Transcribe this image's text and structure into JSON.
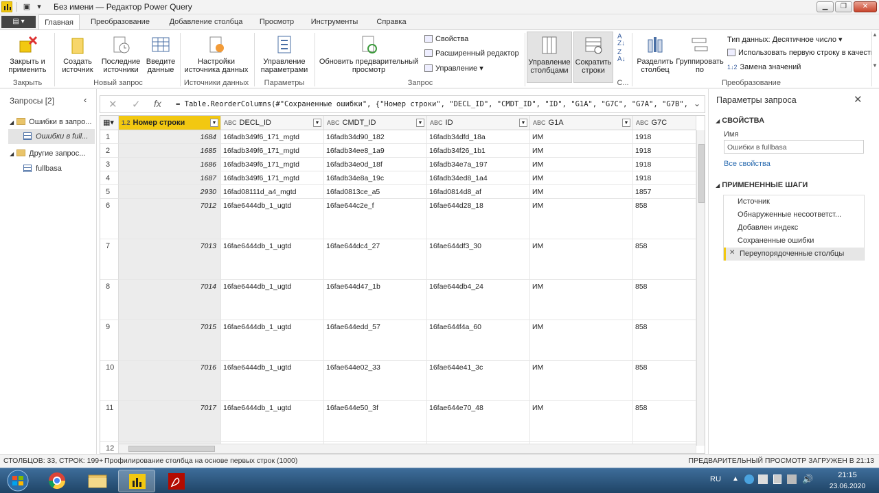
{
  "window": {
    "title": "Без имени — Редактор Power Query",
    "controls": [
      "minimize-icon",
      "restore-icon",
      "close-icon"
    ]
  },
  "tabs": [
    {
      "label": "Главная",
      "active": true
    },
    {
      "label": "Преобразование"
    },
    {
      "label": "Добавление столбца"
    },
    {
      "label": "Просмотр"
    },
    {
      "label": "Инструменты"
    },
    {
      "label": "Справка"
    }
  ],
  "ribbon": {
    "close_apply": "Закрыть и применить",
    "new_source": "Создать источник",
    "recent_sources": "Последние источники",
    "enter_data": "Введите данные",
    "data_source_settings": "Настройки источника данных",
    "manage_params": "Управление параметрами",
    "refresh_preview": "Обновить предварительный просмотр",
    "properties": "Свойства",
    "advanced_editor": "Расширенный редактор",
    "manage": "Управление",
    "manage_columns": "Управление столбцами",
    "reduce_rows": "Сократить строки",
    "split_column": "Разделить столбец",
    "group_by": "Группировать по",
    "data_type": "Тип данных: Десятичное число",
    "first_row_headers": "Использовать первую строку в качестве заголовков",
    "replace_values": "Замена значений",
    "groups": {
      "close": "Закрыть",
      "new_query": "Новый запрос",
      "data_sources": "Источники данных",
      "parameters": "Параметры",
      "query": "Запрос",
      "sort": "С...",
      "transform": "Преобразование"
    }
  },
  "queries": {
    "header": "Запросы [2]",
    "items": [
      {
        "label": "Ошибки в запро...",
        "type": "folder"
      },
      {
        "label": "Ошибки в full...",
        "type": "table",
        "selected": true
      },
      {
        "label": "Другие запрос...",
        "type": "folder"
      },
      {
        "label": "fullbasa",
        "type": "table"
      }
    ]
  },
  "formula": {
    "text": "= Table.ReorderColumns(#\"Сохраненные ошибки\", {\"Номер строки\", \"DECL_ID\", \"CMDT_ID\", \"ID\", \"G1A\", \"G7C\", \"G7A\", \"G7B\","
  },
  "table": {
    "columns": [
      {
        "name": "Номер строки",
        "type": "1.2"
      },
      {
        "name": "DECL_ID",
        "type": "ABC"
      },
      {
        "name": "CMDT_ID",
        "type": "ABC"
      },
      {
        "name": "ID",
        "type": "ABC"
      },
      {
        "name": "G1A",
        "type": "ABC"
      },
      {
        "name": "G7C",
        "type": "ABC"
      }
    ],
    "rows": [
      {
        "n": "1",
        "cells": [
          "1684",
          "16fadb349f6_171_mgtd",
          "16fadb34d90_182",
          "16fadb34dfd_18a",
          "ИМ",
          "1918"
        ]
      },
      {
        "n": "2",
        "cells": [
          "1685",
          "16fadb349f6_171_mgtd",
          "16fadb34ee8_1a9",
          "16fadb34f26_1b1",
          "ИМ",
          "1918"
        ]
      },
      {
        "n": "3",
        "cells": [
          "1686",
          "16fadb349f6_171_mgtd",
          "16fadb34e0d_18f",
          "16fadb34e7a_197",
          "ИМ",
          "1918"
        ]
      },
      {
        "n": "4",
        "cells": [
          "1687",
          "16fadb349f6_171_mgtd",
          "16fadb34e8a_19c",
          "16fadb34ed8_1a4",
          "ИМ",
          "1918"
        ]
      },
      {
        "n": "5",
        "cells": [
          "2930",
          "16fad08111d_a4_mgtd",
          "16fad0813ce_a5",
          "16fad0814d8_af",
          "ИМ",
          "1857"
        ]
      },
      {
        "n": "6",
        "cells": [
          "7012",
          "16fae6444db_1_ugtd",
          "16fae644c2e_f",
          "16fae644d28_18",
          "ИМ",
          "858"
        ]
      },
      {
        "n": "7",
        "cells": [
          "7013",
          "16fae6444db_1_ugtd",
          "16fae644dc4_27",
          "16fae644df3_30",
          "ИМ",
          "858"
        ]
      },
      {
        "n": "8",
        "cells": [
          "7014",
          "16fae6444db_1_ugtd",
          "16fae644d47_1b",
          "16fae644db4_24",
          "ИМ",
          "858"
        ]
      },
      {
        "n": "9",
        "cells": [
          "7015",
          "16fae6444db_1_ugtd",
          "16fae644edd_57",
          "16fae644f4a_60",
          "ИМ",
          "858"
        ]
      },
      {
        "n": "10",
        "cells": [
          "7016",
          "16fae6444db_1_ugtd",
          "16fae644e02_33",
          "16fae644e41_3c",
          "ИМ",
          "858"
        ]
      },
      {
        "n": "11",
        "cells": [
          "7017",
          "16fae6444db_1_ugtd",
          "16fae644e50_3f",
          "16fae644e70_48",
          "ИМ",
          "858"
        ]
      },
      {
        "n": "12",
        "cells": [
          "",
          "",
          "",
          "",
          "",
          ""
        ]
      }
    ]
  },
  "settings": {
    "title": "Параметры запроса",
    "properties_header": "СВОЙСТВА",
    "name_label": "Имя",
    "name_value": "Ошибки в fullbasa",
    "all_properties": "Все свойства",
    "steps_header": "ПРИМЕНЕННЫЕ ШАГИ",
    "steps": [
      {
        "label": "Источник"
      },
      {
        "label": "Обнаруженные несоответст..."
      },
      {
        "label": "Добавлен индекс"
      },
      {
        "label": "Сохраненные ошибки"
      },
      {
        "label": "Переупорядоченные столбцы",
        "selected": true
      }
    ]
  },
  "status": {
    "left": "СТОЛБЦОВ: 33, СТРОК: 199+",
    "middle": "Профилирование столбца на основе первых строк (1000)",
    "right": "ПРЕДВАРИТЕЛЬНЫЙ ПРОСМОТР ЗАГРУЖЕН В 21:13"
  },
  "taskbar": {
    "lang": "RU",
    "time": "21:15",
    "date": "23.06.2020",
    "apps": [
      "windows-start-icon",
      "chrome-icon",
      "file-explorer-icon",
      "power-bi-icon",
      "pdf-reader-icon"
    ]
  },
  "colors": {
    "accent": "#f2c811",
    "link": "#2b6cb0",
    "selected_step": "#e8e8e8",
    "taskbar": "#2b5278"
  }
}
